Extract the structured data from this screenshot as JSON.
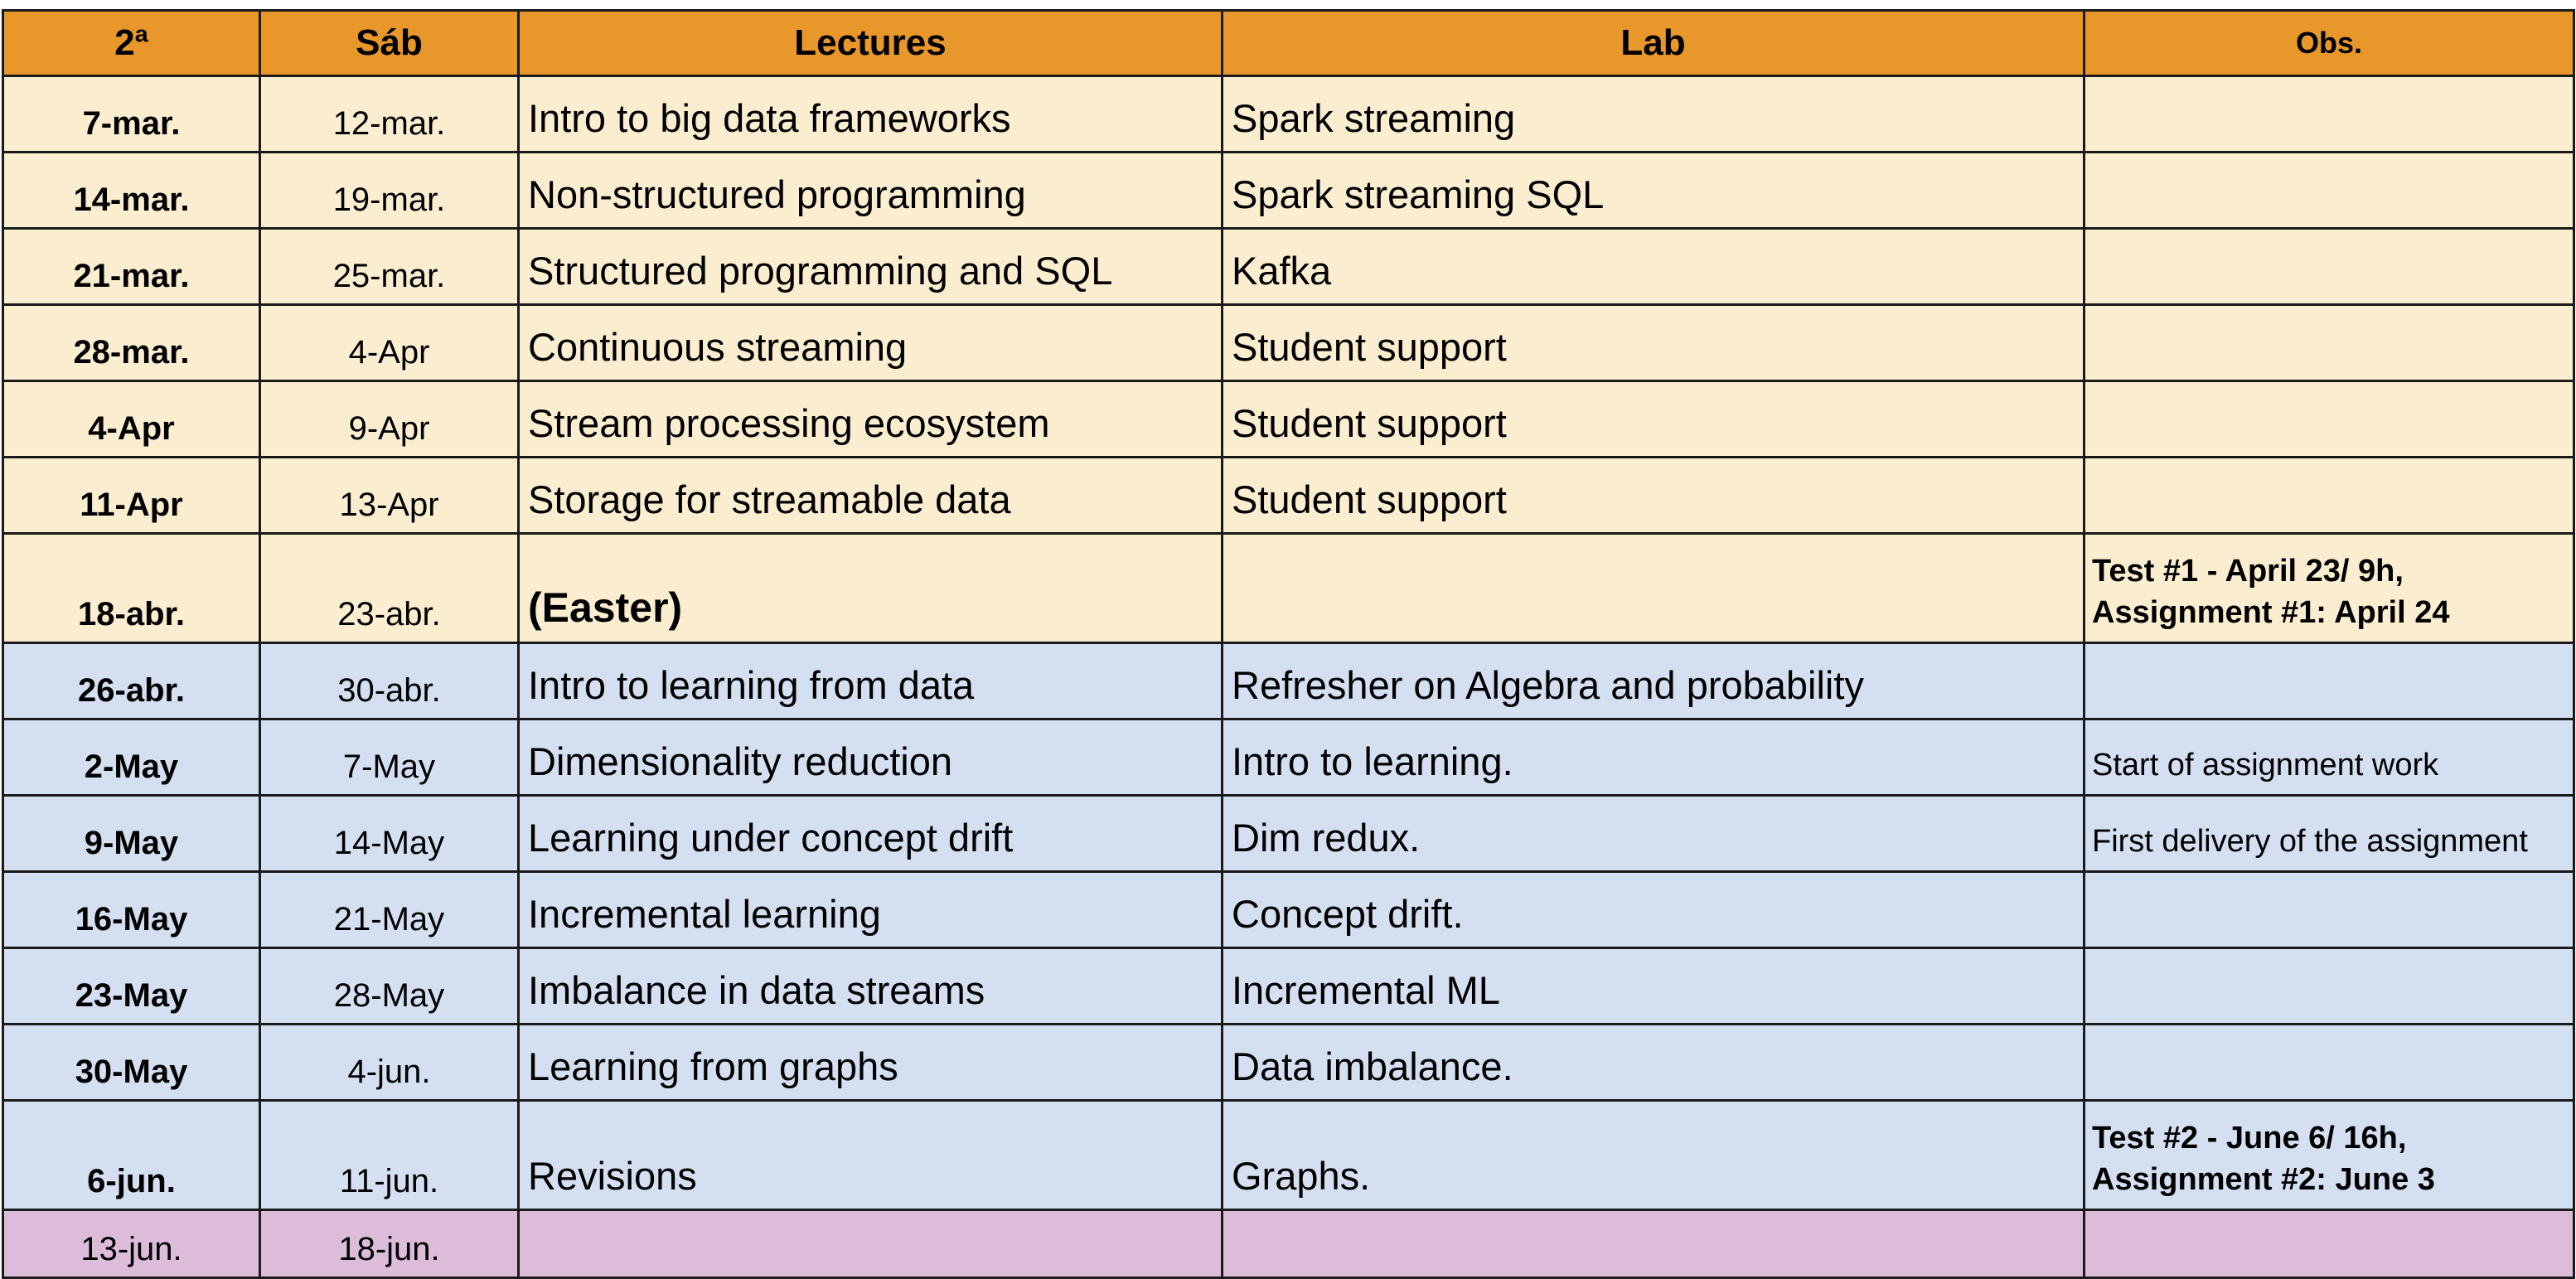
{
  "header": {
    "col_monday": "2ª",
    "col_saturday": "Sáb",
    "col_lectures": "Lectures",
    "col_lab": "Lab",
    "col_obs": "Obs."
  },
  "colors": {
    "header": "#e8972a",
    "part1_rows": "#fbeed0",
    "part2_rows": "#d4e0f1",
    "final_row": "#dcbcd9"
  },
  "rows": [
    {
      "mon": "7-mar.",
      "sat": "12-mar.",
      "lecture": "Intro to big data frameworks",
      "lab": "Spark streaming",
      "obs1": "",
      "obs2": ""
    },
    {
      "mon": "14-mar.",
      "sat": "19-mar.",
      "lecture": "Non-structured programming",
      "lab": "Spark streaming SQL",
      "obs1": "",
      "obs2": ""
    },
    {
      "mon": "21-mar.",
      "sat": "25-mar.",
      "lecture": "Structured programming and SQL",
      "lab": "Kafka",
      "obs1": "",
      "obs2": ""
    },
    {
      "mon": "28-mar.",
      "sat": "4-Apr",
      "lecture": "Continuous streaming",
      "lab": "Student support",
      "obs1": "",
      "obs2": ""
    },
    {
      "mon": "4-Apr",
      "sat": "9-Apr",
      "lecture": "Stream processing ecosystem",
      "lab": "Student support",
      "obs1": "",
      "obs2": ""
    },
    {
      "mon": "11-Apr",
      "sat": "13-Apr",
      "lecture": "Storage for streamable data",
      "lab": "Student support",
      "obs1": "",
      "obs2": ""
    },
    {
      "mon": "18-abr.",
      "sat": "23-abr.",
      "lecture": "(Easter)",
      "lab": "",
      "obs1": "Test #1 - April 23/ 9h,",
      "obs2": "Assignment #1: April 24"
    },
    {
      "mon": "26-abr.",
      "sat": "30-abr.",
      "lecture": "Intro to learning from data",
      "lab": "Refresher on Algebra and probability",
      "obs1": "",
      "obs2": ""
    },
    {
      "mon": "2-May",
      "sat": "7-May",
      "lecture": "Dimensionality reduction",
      "lab": "Intro to learning.",
      "obs1": "Start of assignment work",
      "obs2": ""
    },
    {
      "mon": "9-May",
      "sat": "14-May",
      "lecture": "Learning under concept drift",
      "lab": "Dim redux.",
      "obs1": "First delivery of the assignment",
      "obs2": ""
    },
    {
      "mon": "16-May",
      "sat": "21-May",
      "lecture": "Incremental learning",
      "lab": "Concept drift.",
      "obs1": "",
      "obs2": ""
    },
    {
      "mon": "23-May",
      "sat": "28-May",
      "lecture": "Imbalance in data streams",
      "lab": "Incremental ML",
      "obs1": "",
      "obs2": ""
    },
    {
      "mon": "30-May",
      "sat": "4-jun.",
      "lecture": "Learning from graphs",
      "lab": "Data imbalance.",
      "obs1": "",
      "obs2": ""
    },
    {
      "mon": "6-jun.",
      "sat": "11-jun.",
      "lecture": "Revisions",
      "lab": "Graphs.",
      "obs1": "Test #2 - June 6/ 16h,",
      "obs2": "Assignment #2: June 3"
    },
    {
      "mon": "13-jun.",
      "sat": "18-jun.",
      "lecture": "",
      "lab": "",
      "obs1": "",
      "obs2": ""
    }
  ]
}
